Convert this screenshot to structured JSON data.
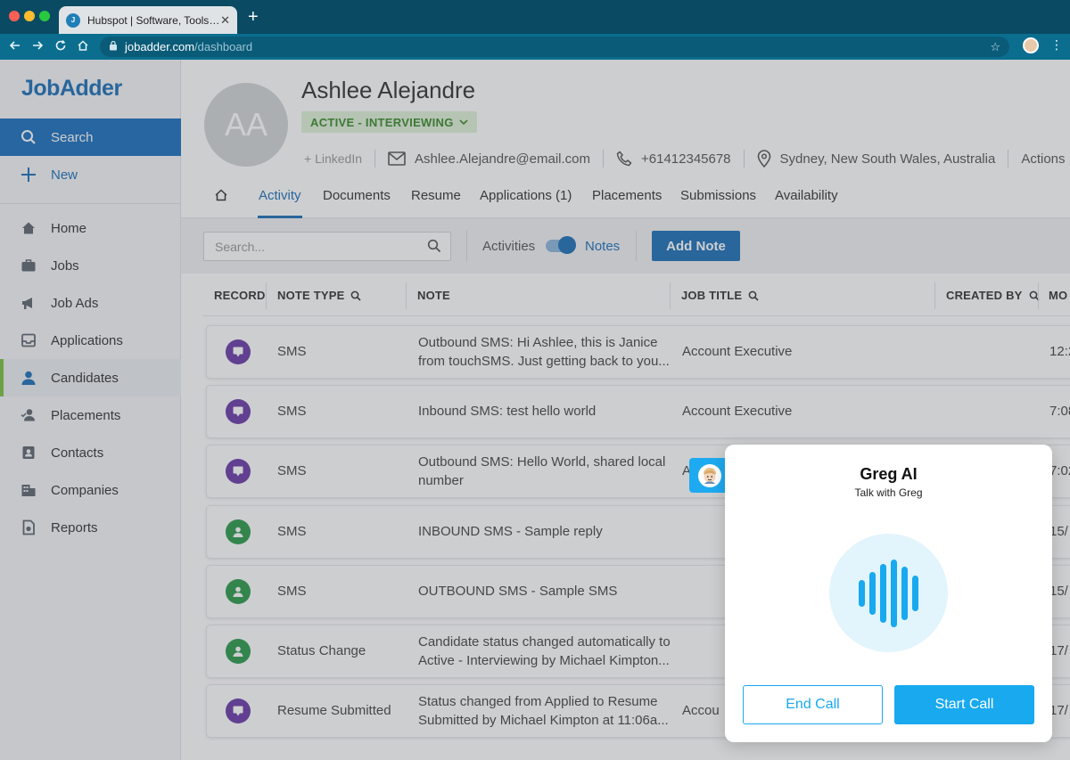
{
  "browser": {
    "tab_title": "Hubspot | Software, Tools, Re...",
    "tab_favicon": "J",
    "tab_close": "✕",
    "new_tab": "+",
    "url_host": "jobadder.com",
    "url_path": "/dashboard"
  },
  "sidebar": {
    "logo": "JobAdder",
    "items": [
      {
        "label": "Search",
        "icon": "search-icon"
      },
      {
        "label": "New",
        "icon": "plus-icon"
      },
      {
        "label": "Home",
        "icon": "home-icon"
      },
      {
        "label": "Jobs",
        "icon": "briefcase-icon"
      },
      {
        "label": "Job Ads",
        "icon": "megaphone-icon"
      },
      {
        "label": "Applications",
        "icon": "inbox-icon"
      },
      {
        "label": "Candidates",
        "icon": "person-icon"
      },
      {
        "label": "Placements",
        "icon": "person-check-icon"
      },
      {
        "label": "Contacts",
        "icon": "contact-card-icon"
      },
      {
        "label": "Companies",
        "icon": "building-icon"
      },
      {
        "label": "Reports",
        "icon": "report-icon"
      }
    ]
  },
  "candidate": {
    "initials": "AA",
    "name": "Ashlee Alejandre",
    "status": "ACTIVE - INTERVIEWING",
    "linkedin": "+ LinkedIn",
    "email": "Ashlee.Alejandre@email.com",
    "phone": "+61412345678",
    "location": "Sydney, New South Wales, Australia",
    "actions": "Actions"
  },
  "tabs": [
    "Activity",
    "Documents",
    "Resume",
    "Applications (1)",
    "Placements",
    "Submissions",
    "Availability"
  ],
  "toolbar": {
    "search_placeholder": "Search...",
    "toggle_left": "Activities",
    "toggle_right": "Notes",
    "add_note": "Add Note"
  },
  "table": {
    "headers": [
      "RECORD",
      "NOTE TYPE",
      "NOTE",
      "JOB TITLE",
      "CREATED BY",
      "MO"
    ],
    "rows": [
      {
        "color": "purple",
        "type": "SMS",
        "note1": "Outbound SMS: Hi Ashlee, this is Janice",
        "note2": "from touchSMS. Just getting back to you...",
        "job": "Account Executive",
        "date": "12:2"
      },
      {
        "color": "purple",
        "type": "SMS",
        "note1": "Inbound SMS: test hello world",
        "note2": "",
        "job": "Account Executive",
        "date": "7:08"
      },
      {
        "color": "purple",
        "type": "SMS",
        "note1": "Outbound SMS: Hello World, shared local",
        "note2": "number",
        "job": "A",
        "date": "7:02"
      },
      {
        "color": "green",
        "type": "SMS",
        "note1": "INBOUND SMS - Sample reply",
        "note2": "",
        "job": "",
        "date": "15/"
      },
      {
        "color": "green",
        "type": "SMS",
        "note1": "OUTBOUND SMS - Sample SMS",
        "note2": "",
        "job": "",
        "date": "15/"
      },
      {
        "color": "green",
        "type": "Status Change",
        "note1": "Candidate status changed automatically to",
        "note2": "Active - Interviewing by Michael Kimpton...",
        "job": "",
        "date": "17/"
      },
      {
        "color": "purple",
        "type": "Resume Submitted",
        "note1": "Status changed from Applied to Resume",
        "note2": "Submitted by Michael Kimpton at 11:06a...",
        "job": "Accou",
        "date": "17/"
      }
    ]
  },
  "greg": {
    "title": "Greg AI",
    "subtitle": "Talk with Greg",
    "end_call": "End Call",
    "start_call": "Start Call"
  },
  "colors": {
    "brand_blue": "#1b6fb8",
    "greg_accent": "#18a9ef",
    "status_green": "#3a8a2a"
  }
}
